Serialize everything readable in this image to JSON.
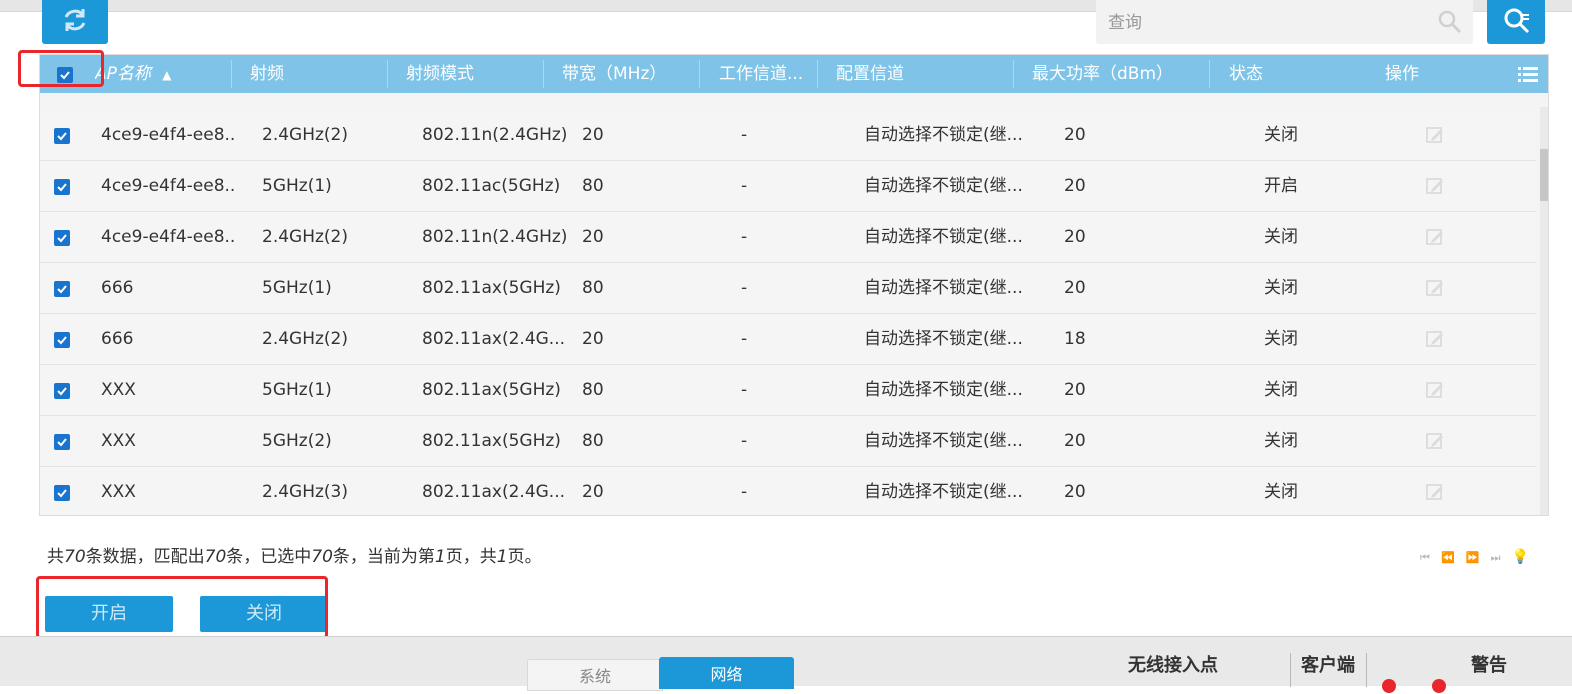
{
  "toolbar": {
    "refresh_icon": "refresh-icon",
    "search_placeholder": "查询",
    "search_icon": "search-icon",
    "search_button_icon": "search-filter-icon"
  },
  "table": {
    "headers": {
      "ap_name": "AP名称",
      "radio": "射频",
      "radio_mode": "射频模式",
      "bandwidth": "带宽（MHz）",
      "work_channel": "工作信道...",
      "config_channel": "配置信道",
      "max_power": "最大功率（dBm）",
      "status": "状态",
      "action": "操作"
    },
    "sort_indicator": "▲",
    "column_menu_icon": "list-icon",
    "rows": [
      {
        "ap_name": "4ce9-e4f4-ee8...",
        "radio": "2.4GHz(2)",
        "mode": "802.11n(2.4GHz)",
        "bandwidth": "20",
        "work_channel": "-",
        "config_channel": "自动选择不锁定(继...",
        "max_power": "20",
        "status": "关闭"
      },
      {
        "ap_name": "4ce9-e4f4-ee8...",
        "radio": "5GHz(1)",
        "mode": "802.11ac(5GHz)",
        "bandwidth": "80",
        "work_channel": "-",
        "config_channel": "自动选择不锁定(继...",
        "max_power": "20",
        "status": "开启"
      },
      {
        "ap_name": "4ce9-e4f4-ee8...",
        "radio": "2.4GHz(2)",
        "mode": "802.11n(2.4GHz)",
        "bandwidth": "20",
        "work_channel": "-",
        "config_channel": "自动选择不锁定(继...",
        "max_power": "20",
        "status": "关闭"
      },
      {
        "ap_name": "666",
        "radio": "5GHz(1)",
        "mode": "802.11ax(5GHz)",
        "bandwidth": "80",
        "work_channel": "-",
        "config_channel": "自动选择不锁定(继...",
        "max_power": "20",
        "status": "关闭"
      },
      {
        "ap_name": "666",
        "radio": "2.4GHz(2)",
        "mode": "802.11ax(2.4G...",
        "bandwidth": "20",
        "work_channel": "-",
        "config_channel": "自动选择不锁定(继...",
        "max_power": "18",
        "status": "关闭"
      },
      {
        "ap_name": "XXX",
        "radio": "5GHz(1)",
        "mode": "802.11ax(5GHz)",
        "bandwidth": "80",
        "work_channel": "-",
        "config_channel": "自动选择不锁定(继...",
        "max_power": "20",
        "status": "关闭"
      },
      {
        "ap_name": "XXX",
        "radio": "5GHz(2)",
        "mode": "802.11ax(5GHz)",
        "bandwidth": "80",
        "work_channel": "-",
        "config_channel": "自动选择不锁定(继...",
        "max_power": "20",
        "status": "关闭"
      },
      {
        "ap_name": "XXX",
        "radio": "2.4GHz(3)",
        "mode": "802.11ax(2.4G...",
        "bandwidth": "20",
        "work_channel": "-",
        "config_channel": "自动选择不锁定(继...",
        "max_power": "20",
        "status": "关闭"
      }
    ]
  },
  "summary": {
    "prefix": "共",
    "total": "70",
    "text1": "条数据，匹配出",
    "matched": "70",
    "text2": "条，已选中",
    "selected": "70",
    "text3": "条，当前为第",
    "page": "1",
    "text4": "页，共",
    "pages": "1",
    "text5": "页。"
  },
  "pager": {
    "first": "⏮",
    "prev": "⏪",
    "next": "⏩",
    "last": "⏭",
    "help": "💡"
  },
  "actions": {
    "enable_label": "开启",
    "disable_label": "关闭"
  },
  "bottom": {
    "tab_system": "系统",
    "tab_network": "网络",
    "stat_ap": "无线接入点",
    "stat_client": "客户端",
    "stat_alarm": "警告"
  },
  "colors": {
    "accent": "#1c98d8",
    "header": "#7fc4e8",
    "highlight": "#e8262b"
  }
}
